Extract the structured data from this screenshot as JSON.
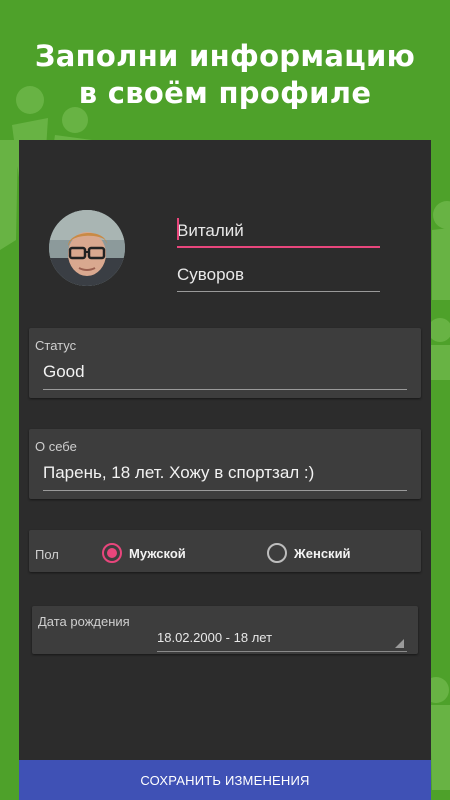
{
  "headline": {
    "line1": "Заполни информацию",
    "line2": "в своём профиле"
  },
  "profile": {
    "first_name": "Виталий",
    "last_name": "Суворов"
  },
  "status": {
    "label": "Статус",
    "value": "Good"
  },
  "about": {
    "label": "О себе",
    "value": "Парень, 18 лет. Хожу в спортзал :)"
  },
  "gender": {
    "label": "Пол",
    "male": "Мужской",
    "female": "Женский",
    "selected": "male"
  },
  "birthdate": {
    "label": "Дата рождения",
    "value": "18.02.2000 - 18 лет"
  },
  "save_button": {
    "label": "СОХРАНИТЬ ИЗМЕНЕНИЯ"
  },
  "colors": {
    "background": "#4ea12a",
    "panel": "#2c2c2c",
    "accent": "#e8467c",
    "button": "#3f51b5"
  }
}
